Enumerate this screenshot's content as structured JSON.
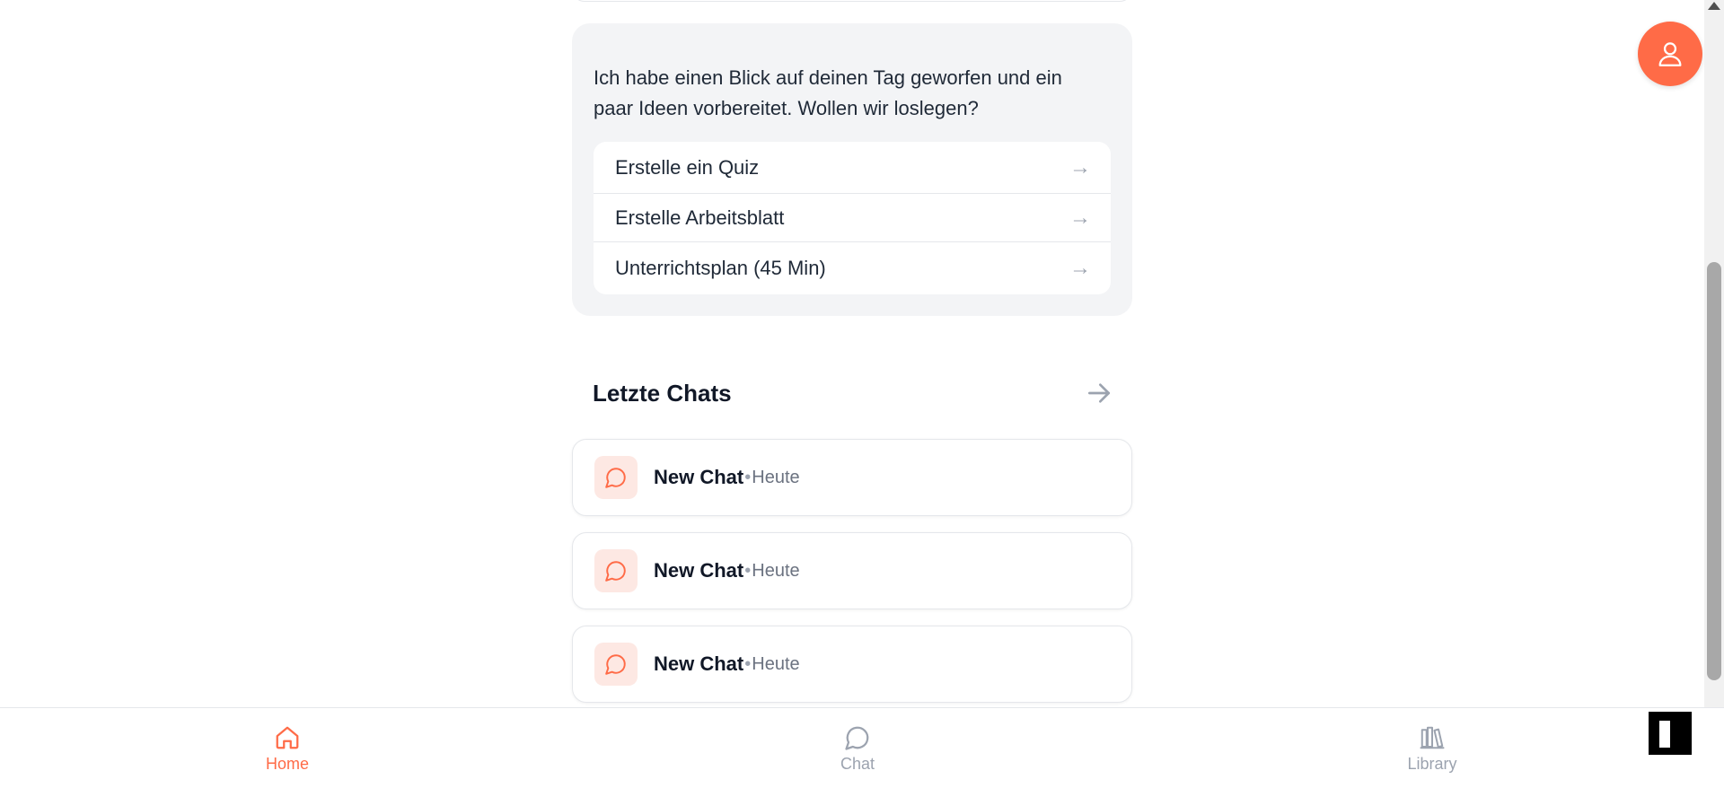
{
  "suggestions": {
    "intro": "Ich habe einen Blick auf deinen Tag geworfen und ein paar Ideen vorbereitet. Wollen wir loslegen?",
    "actions": [
      {
        "label": "Erstelle ein Quiz",
        "arrow": "→"
      },
      {
        "label": "Erstelle Arbeitsblatt",
        "arrow": "→"
      },
      {
        "label": "Unterrichtsplan (45 Min)",
        "arrow": "→"
      }
    ]
  },
  "recent_chats": {
    "title": "Letzte Chats",
    "separator": "•",
    "items": [
      {
        "title": "New Chat",
        "date": "Heute"
      },
      {
        "title": "New Chat",
        "date": "Heute"
      },
      {
        "title": "New Chat",
        "date": "Heute"
      }
    ]
  },
  "bottom_nav": {
    "home": "Home",
    "chat": "Chat",
    "library": "Library",
    "active": "home"
  },
  "colors": {
    "accent": "#ff6b47",
    "accent_soft": "#fde8e3",
    "muted": "#9ca3af",
    "card_bg": "#f3f4f6"
  },
  "icons": {
    "profile": "user-icon",
    "chat_item": "speech-bubble-icon",
    "see_all": "arrow-right-icon",
    "nav_home": "home-icon",
    "nav_chat": "chat-bubble-icon",
    "nav_library": "library-icon"
  }
}
